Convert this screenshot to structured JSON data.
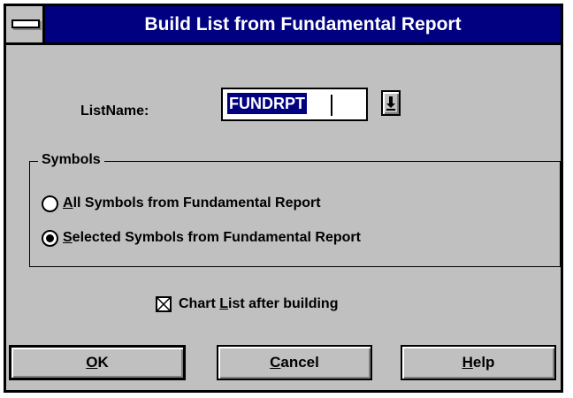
{
  "window": {
    "title": "Build List from Fundamental Report"
  },
  "list_name": {
    "label": "ListName:",
    "value": "FUNDRPT",
    "dropdown_icon": "down-arrow-icon"
  },
  "symbols_group": {
    "label": "Symbols",
    "options": [
      {
        "mnemonic": "A",
        "rest": "ll Symbols from Fundamental Report",
        "selected": false
      },
      {
        "mnemonic": "S",
        "rest": "elected Symbols from Fundamental Report",
        "selected": true
      }
    ]
  },
  "chart_checkbox": {
    "pre": "Chart ",
    "mnemonic": "L",
    "rest": "ist after building",
    "checked": true
  },
  "buttons": {
    "ok": {
      "mnemonic": "O",
      "rest": "K"
    },
    "cancel": {
      "mnemonic": "C",
      "rest": "ancel"
    },
    "help": {
      "mnemonic": "H",
      "rest": "elp"
    }
  },
  "colors": {
    "title_bar": "#000080",
    "dialog_face": "#c0c0c0",
    "selection": "#000080"
  }
}
